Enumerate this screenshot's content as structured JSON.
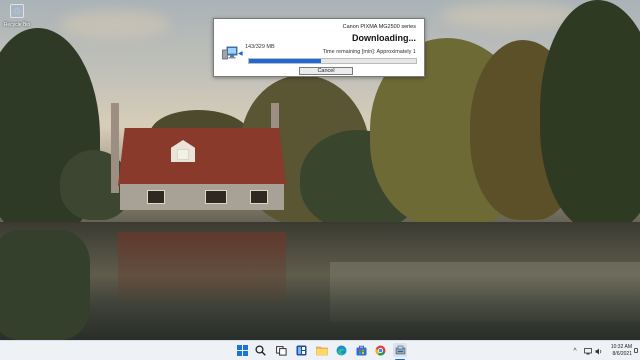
{
  "desktop": {
    "icons": [
      {
        "label": "Recycle Bin",
        "icon": "recycle-bin-icon"
      }
    ]
  },
  "dialog": {
    "title": "Canon PIXMA MG2500 series",
    "status": "Downloading...",
    "size": "143/329 MB",
    "remaining": "Time remaining [min]: Approximately 1",
    "progress_percent": 43,
    "cancel_label": "Cancel",
    "icons": {
      "computer": "computer-icon",
      "arrow": "download-arrow-icon"
    },
    "colors": {
      "progress": "#1f68d6"
    }
  },
  "taskbar": {
    "apps": [
      {
        "name": "start",
        "icon": "windows-start-icon"
      },
      {
        "name": "search",
        "icon": "search-icon"
      },
      {
        "name": "task-view",
        "icon": "task-view-icon"
      },
      {
        "name": "widgets",
        "icon": "widgets-icon"
      },
      {
        "name": "file-explorer",
        "icon": "folder-icon"
      },
      {
        "name": "edge",
        "icon": "edge-browser-icon"
      },
      {
        "name": "store",
        "icon": "store-icon"
      },
      {
        "name": "chrome",
        "icon": "chrome-icon"
      },
      {
        "name": "installer",
        "icon": "installer-icon"
      }
    ],
    "tray": {
      "chevron": "^",
      "icons": [
        "network-icon",
        "volume-icon"
      ],
      "time": "10:32 AM",
      "date": "8/6/2021"
    }
  }
}
